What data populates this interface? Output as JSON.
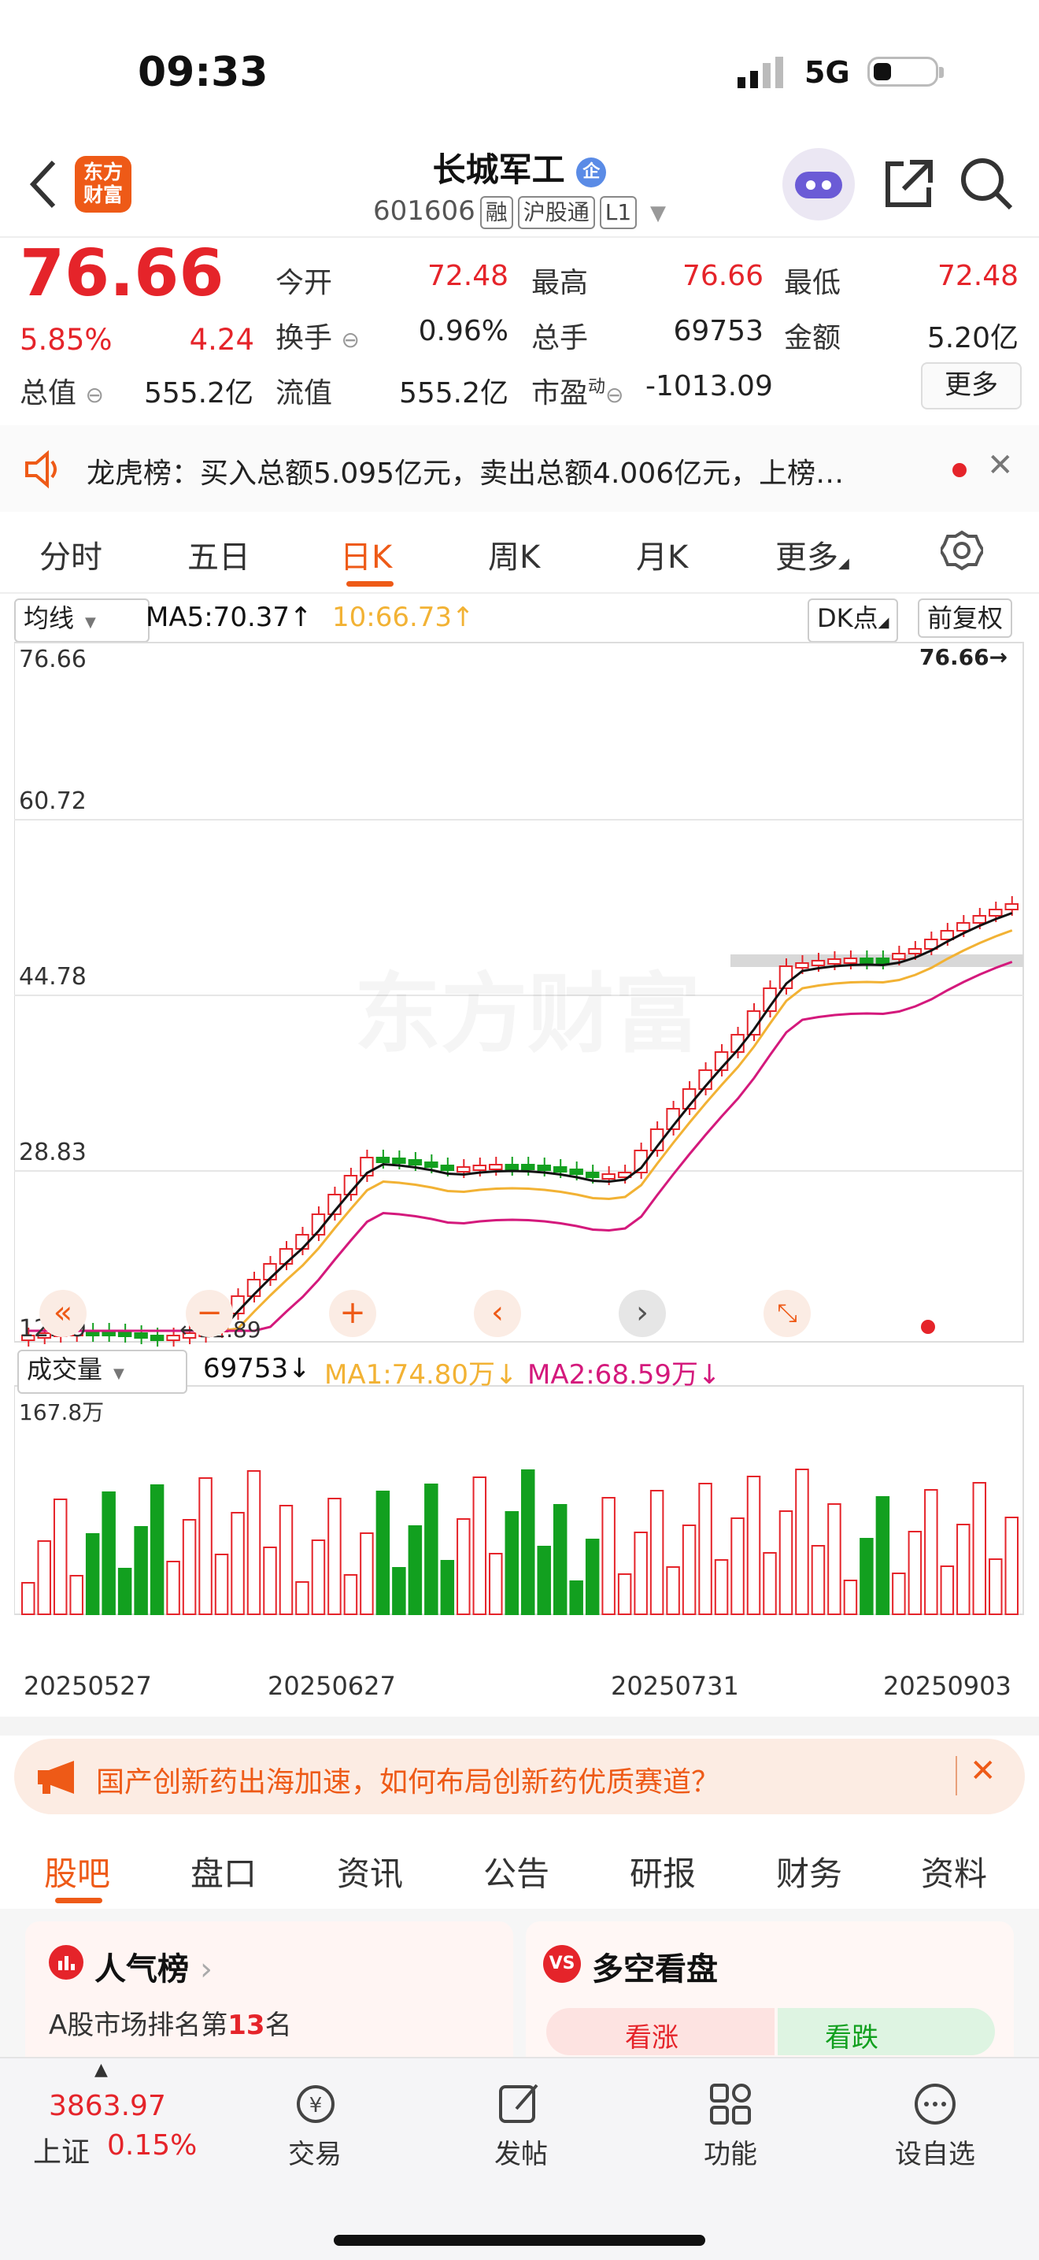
{
  "status": {
    "time": "09:33",
    "network": "5G"
  },
  "header": {
    "title": "长城军工",
    "badge": "企",
    "code": "601606",
    "tags": [
      "融",
      "沪股通",
      "L1"
    ],
    "logo_line1": "东方",
    "logo_line2": "财富"
  },
  "quote": {
    "price": "76.66",
    "change_pct": "5.85%",
    "change": "4.24",
    "fields": [
      {
        "label": "今开",
        "value": "72.48"
      },
      {
        "label": "最高",
        "value": "76.66"
      },
      {
        "label": "最低",
        "value": "72.48"
      },
      {
        "label": "换手",
        "value": "0.96%"
      },
      {
        "label": "总手",
        "value": "69753"
      },
      {
        "label": "金额",
        "value": "5.20亿"
      },
      {
        "label": "总值",
        "value": "555.2亿"
      },
      {
        "label": "流值",
        "value": "555.2亿"
      },
      {
        "label": "市盈",
        "sup": "动",
        "value": "-1013.09"
      }
    ],
    "more_label": "更多"
  },
  "notice": {
    "text": "龙虎榜：买入总额5.095亿元，卖出总额4.006亿元，上榜…"
  },
  "chart_tabs": [
    "分时",
    "五日",
    "日K",
    "周K",
    "月K",
    "更多"
  ],
  "active_chart_tab": "日K",
  "kline_toolbar": {
    "ma_select": "均线",
    "ma5": "MA5:70.37↑",
    "ma10": "10:66.73↑",
    "dk": "DK点",
    "adjust": "前复权"
  },
  "colors": {
    "up": "#e5242a",
    "down": "#12a01f",
    "ma5": "#111111",
    "ma10": "#f2b234",
    "ma20": "#d4197c",
    "accent": "#ee5a17"
  },
  "chart_data": {
    "type": "candlestick",
    "y_ticks": [
      "76.66",
      "60.72",
      "44.78",
      "28.83",
      "12.89"
    ],
    "ylim": [
      12.89,
      76.66
    ],
    "last_price_label": "76.66",
    "low_label": "12.89",
    "watermark": "东方财富",
    "x_labels": [
      "20250527",
      "20250627",
      "20250731",
      "20250903"
    ],
    "volume": {
      "title": "成交量",
      "value": "69753↓",
      "ma1": "MA1:74.80万↓",
      "ma2": "MA2:68.59万↓",
      "max_label": "167.8万"
    }
  },
  "promo": {
    "text": "国产创新药出海加速，如何布局创新药优质赛道？"
  },
  "section_tabs": [
    "股吧",
    "盘口",
    "资讯",
    "公告",
    "研报",
    "财务",
    "资料"
  ],
  "active_section_tab": "股吧",
  "popularity": {
    "title": "人气榜",
    "rank_text_prefix": "A股市场排名第",
    "rank": "13",
    "rank_suffix": "名"
  },
  "sentiment": {
    "title": "多空看盘",
    "bull": "看涨",
    "bear": "看跌"
  },
  "bottom_bar": {
    "index_value": "3863.97",
    "index_name": "上证",
    "index_change": "0.15%",
    "nav": [
      "交易",
      "发帖",
      "功能",
      "设自选"
    ]
  }
}
